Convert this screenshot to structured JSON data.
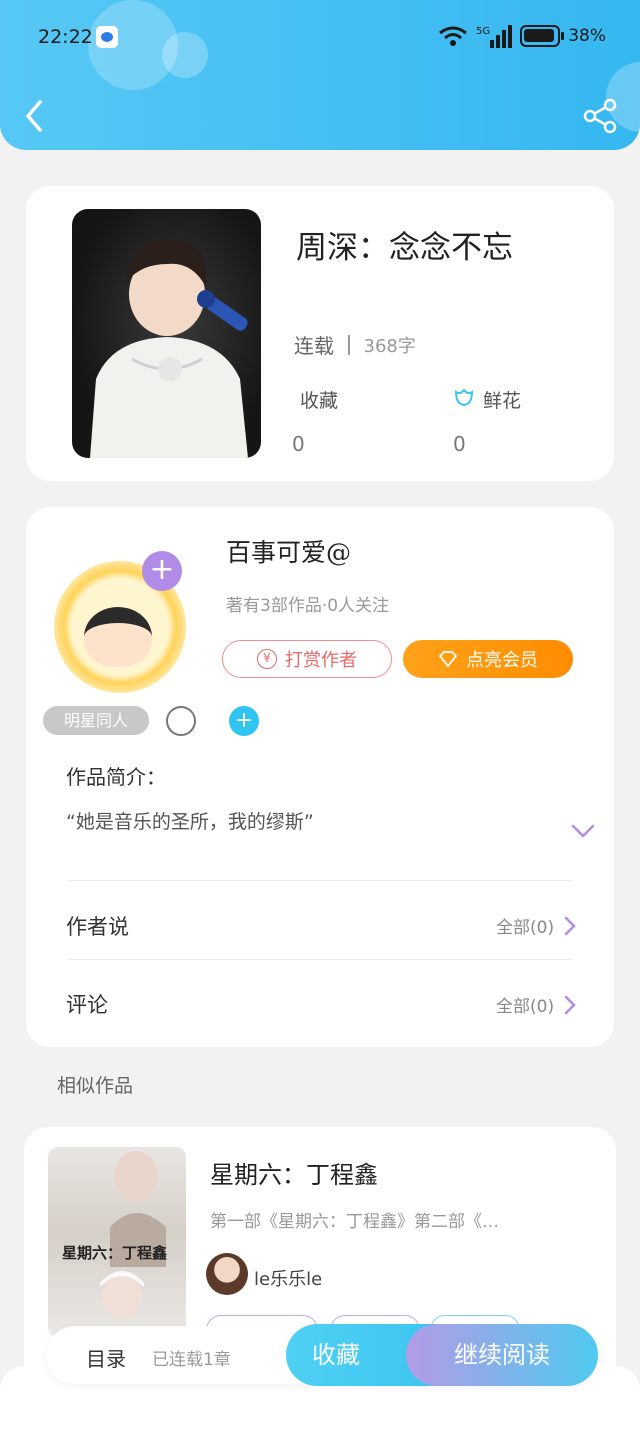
{
  "status_bar": {
    "time": "22:22",
    "battery": "38%",
    "network": "5G"
  },
  "header": {
    "back_icon": "back-arrow-icon",
    "share_icon": "share-icon"
  },
  "book": {
    "title": "周深：念念不忘",
    "status": "连载",
    "word_count": "368字",
    "favorites_label": "收藏",
    "favorites_count": "0",
    "flowers_label": "鲜花",
    "flowers_count": "0"
  },
  "author": {
    "name": "百事可爱@",
    "meta": "著有3部作品·0人关注",
    "tip_button": "打赏作者",
    "vip_button": "点亮会员",
    "tag": "明星同人",
    "intro_heading": "作品简介：",
    "intro_text": "“她是音乐的圣所，我的缪斯”"
  },
  "sections": {
    "author_says": "作者说",
    "author_says_all": "全部(0)",
    "comments": "评论",
    "comments_all": "全部(0)"
  },
  "similar": {
    "heading": "相似作品",
    "items": [
      {
        "title": "星期六：丁程鑫",
        "cover_text": "星期六：丁程鑫",
        "description": "第一部《星期六：丁程鑫》第二部《…",
        "author": "le乐乐le"
      }
    ]
  },
  "bottom_bar": {
    "toc": "目录",
    "toc_status": "已连载1章",
    "collect": "收藏",
    "continue_reading": "继续阅读"
  },
  "colors": {
    "header_blue": "#35b7f0",
    "vip_orange": "#ff8c00",
    "accent_purple": "#b08ce6",
    "tip_red": "#e56a6a"
  }
}
